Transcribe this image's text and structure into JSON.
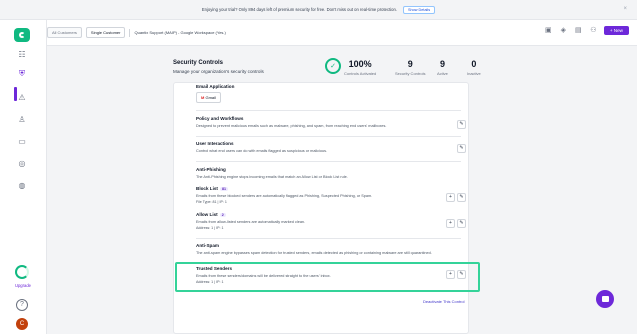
{
  "banner": {
    "text": "Enjoying your trial? Only 894 days left of premium security for free. Don't miss out on real-time protection.",
    "button": "Show Details",
    "close_icon": "close-icon"
  },
  "header": {
    "all_customers": "All Customers",
    "single_customer": "Single Customer",
    "breadcrumb": "Quantix Support (MAIP) - Google Workspace (Yes.)",
    "new_button": "+ New"
  },
  "sidebar": {
    "upgrade_label": "Upgrade",
    "help": "?",
    "avatar": "C"
  },
  "summary": {
    "title": "Security Controls",
    "subtitle": "Manage your organization's security controls",
    "controls_pct": "100%",
    "controls_pct_label": "Controls Activated",
    "security_controls": "9",
    "security_controls_label": "Security Controls",
    "active": "9",
    "active_label": "Active",
    "inactive": "0",
    "inactive_label": "Inactive"
  },
  "card": {
    "email_app": {
      "title": "Email Application",
      "gmail": "Gmail"
    },
    "policy": {
      "title": "Policy and Workflows",
      "desc": "Designed to prevent malicious emails such as malware, phishing, and spam, from reaching end users' mailboxes."
    },
    "user_interactions": {
      "title": "User Interactions",
      "desc": "Control what end users can do with emails flagged as suspicious or malicious."
    },
    "anti_phishing": {
      "title": "Anti-Phishing",
      "desc": "The Anti-Phishing engine stops incoming emails that match an Allow List or Block List rule."
    },
    "block_list": {
      "title": "Block List",
      "count": "81",
      "desc": "Emails from these blocked senders are automatically flagged as Phishing, Suspected Phishing, or Spam.",
      "sub": "File Type: 81 | IP: 1"
    },
    "allow_list": {
      "title": "Allow List",
      "count": "2",
      "desc": "Emails from allow-listed senders are automatically marked clean.",
      "sub": "Address: 1 | IP: 1"
    },
    "anti_spam": {
      "title": "Anti-Spam",
      "desc": "The anti-spam engine bypasses spam detection for trusted senders, emails detected as phishing or containing malware are still quarantined."
    },
    "trusted_senders": {
      "title": "Trusted Senders",
      "desc": "Emails from these senders/domains will be delivered straight to the users' inbox.",
      "sub": "Address: 1 | IP: 1"
    },
    "footer_link": "Deactivate This Control"
  }
}
